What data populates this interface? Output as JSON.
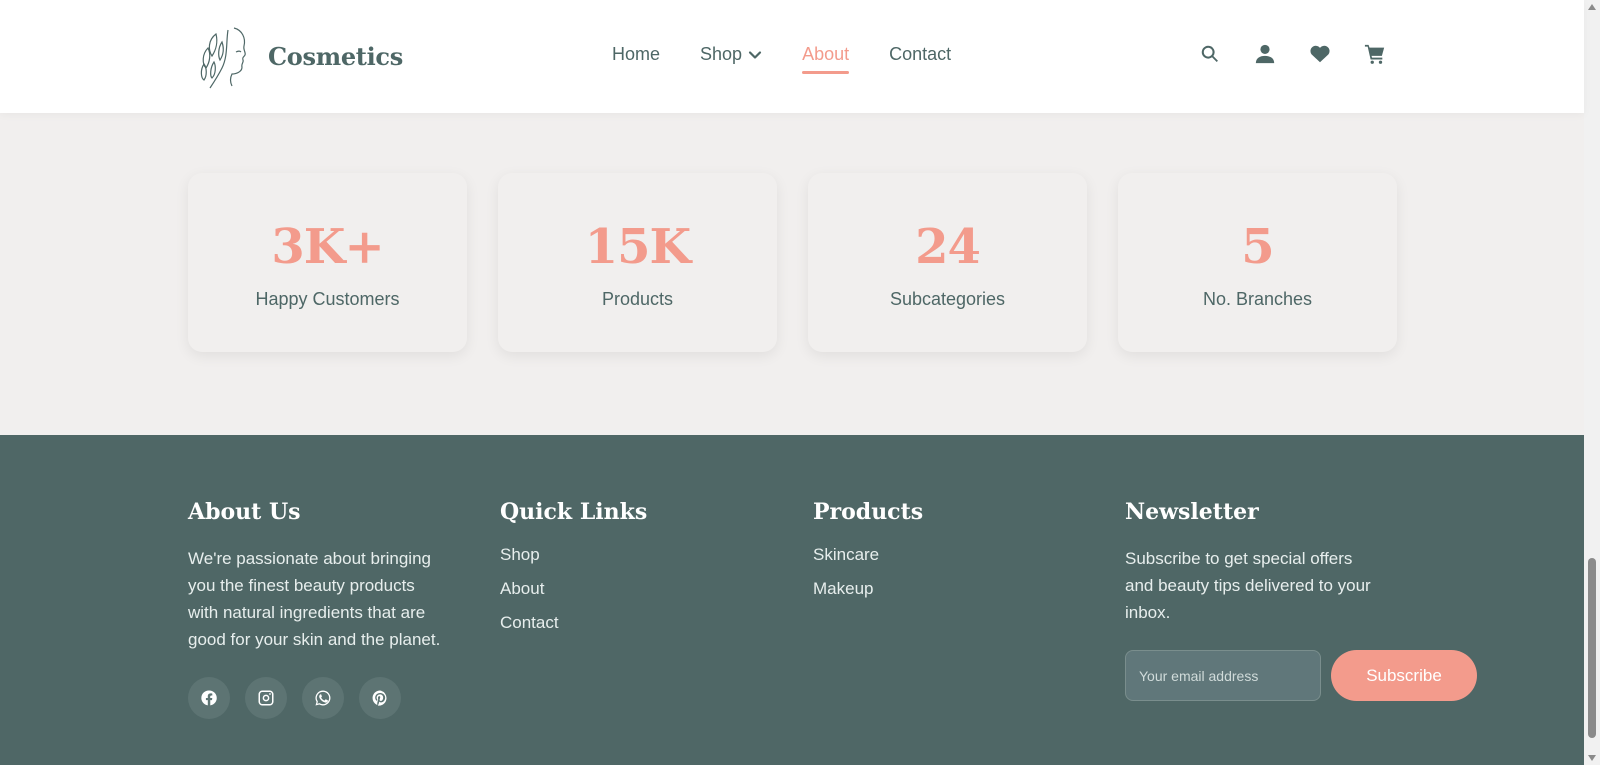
{
  "header": {
    "logo_text": "Cosmetics",
    "nav": [
      {
        "label": "Home",
        "active": false
      },
      {
        "label": "Shop",
        "active": false,
        "has_dropdown": true
      },
      {
        "label": "About",
        "active": true
      },
      {
        "label": "Contact",
        "active": false
      }
    ],
    "icons": [
      "search-icon",
      "user-icon",
      "heart-icon",
      "cart-icon"
    ]
  },
  "stats": [
    {
      "value": "3K+",
      "label": "Happy Customers"
    },
    {
      "value": "15K",
      "label": "Products"
    },
    {
      "value": "24",
      "label": "Subcategories"
    },
    {
      "value": "5",
      "label": "No. Branches"
    }
  ],
  "footer": {
    "about": {
      "title": "About Us",
      "text": "We're passionate about bringing you the finest beauty products with natural ingredients that are good for your skin and the planet.",
      "social": [
        "facebook-icon",
        "instagram-icon",
        "whatsapp-icon",
        "pinterest-icon"
      ]
    },
    "quick_links": {
      "title": "Quick Links",
      "links": [
        "Shop",
        "About",
        "Contact"
      ]
    },
    "products": {
      "title": "Products",
      "links": [
        "Skincare",
        "Makeup"
      ]
    },
    "newsletter": {
      "title": "Newsletter",
      "text": "Subscribe to get special offers and beauty tips delivered to your inbox.",
      "placeholder": "Your email address",
      "button": "Subscribe"
    }
  },
  "colors": {
    "accent": "#f39b8c",
    "primary": "#4e6766",
    "background": "#f1efee",
    "footer": "#4f6766"
  }
}
